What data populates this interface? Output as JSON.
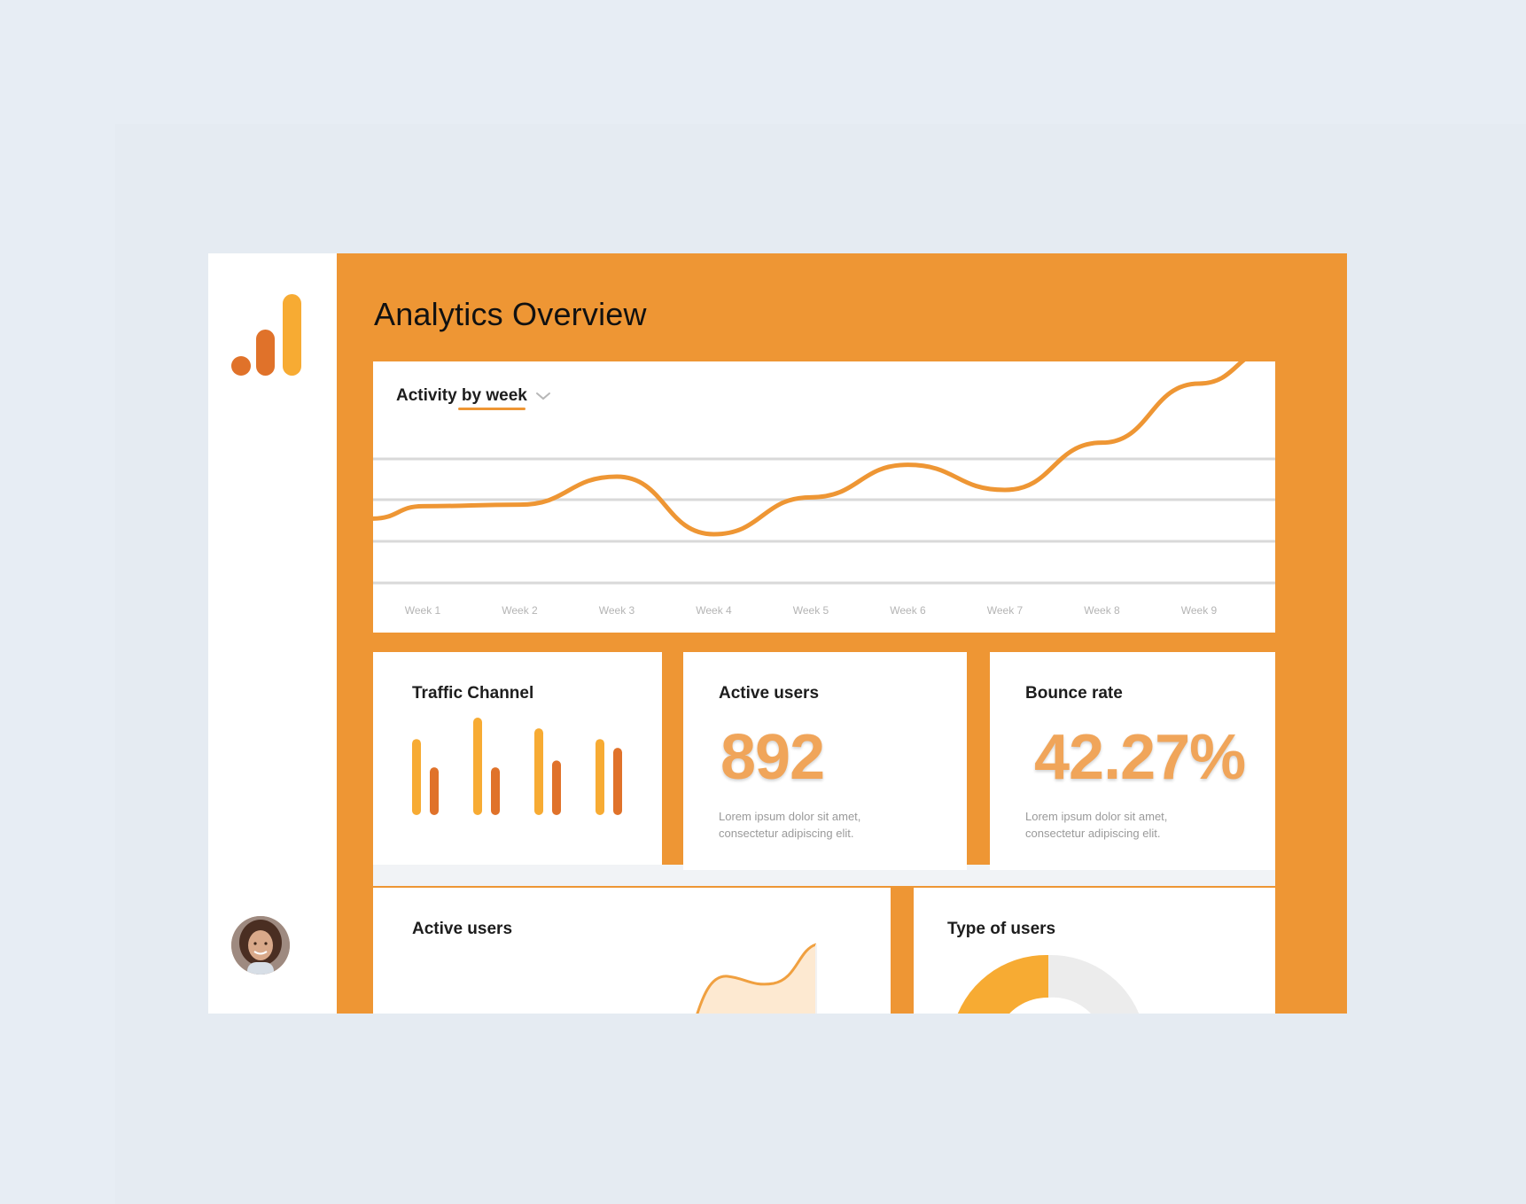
{
  "page": {
    "title": "Analytics Overview"
  },
  "sidebar": {
    "logo_icon": "bar-chart-logo-icon",
    "avatar_icon": "user-avatar"
  },
  "activity_card": {
    "dropdown_label": "Activity by week",
    "dropdown_icon": "chevron-down-icon",
    "weeks": [
      "Week 1",
      "Week 2",
      "Week 3",
      "Week 4",
      "Week 5",
      "Week 6",
      "Week 7",
      "Week 8",
      "Week 9"
    ]
  },
  "traffic_card": {
    "title": "Traffic Channel"
  },
  "active_users_card": {
    "title": "Active users",
    "value": "892",
    "description_line1": "Lorem ipsum dolor sit amet,",
    "description_line2": "consectetur adipiscing elit."
  },
  "bounce_card": {
    "title": "Bounce rate",
    "value": "42.27%",
    "description_line1": "Lorem ipsum dolor sit amet,",
    "description_line2": "consectetur adipiscing elit."
  },
  "active_users_chart_card": {
    "title": "Active users"
  },
  "type_of_users_card": {
    "title": "Type of users"
  },
  "colors": {
    "accent": "#ee9634",
    "accent_dark": "#e0722a",
    "accent_light": "#f7ab33",
    "background": "#e7edf4"
  },
  "chart_data": [
    {
      "type": "line",
      "x": [
        "Week 1",
        "Week 2",
        "Week 3",
        "Week 4",
        "Week 5",
        "Week 6",
        "Week 7",
        "Week 8",
        "Week 9"
      ],
      "series": [
        {
          "values": [
            0.52,
            0.53,
            0.72,
            0.33,
            0.58,
            0.8,
            0.63,
            0.95,
            1.35
          ]
        }
      ],
      "grid": true
    },
    {
      "type": "bar",
      "categories": [
        "1",
        "2",
        "3",
        "4"
      ],
      "series": [
        {
          "values": [
            0.78,
            1.0,
            0.89,
            0.78
          ]
        },
        {
          "values": [
            0.49,
            0.49,
            0.56,
            0.69
          ]
        }
      ]
    }
  ]
}
